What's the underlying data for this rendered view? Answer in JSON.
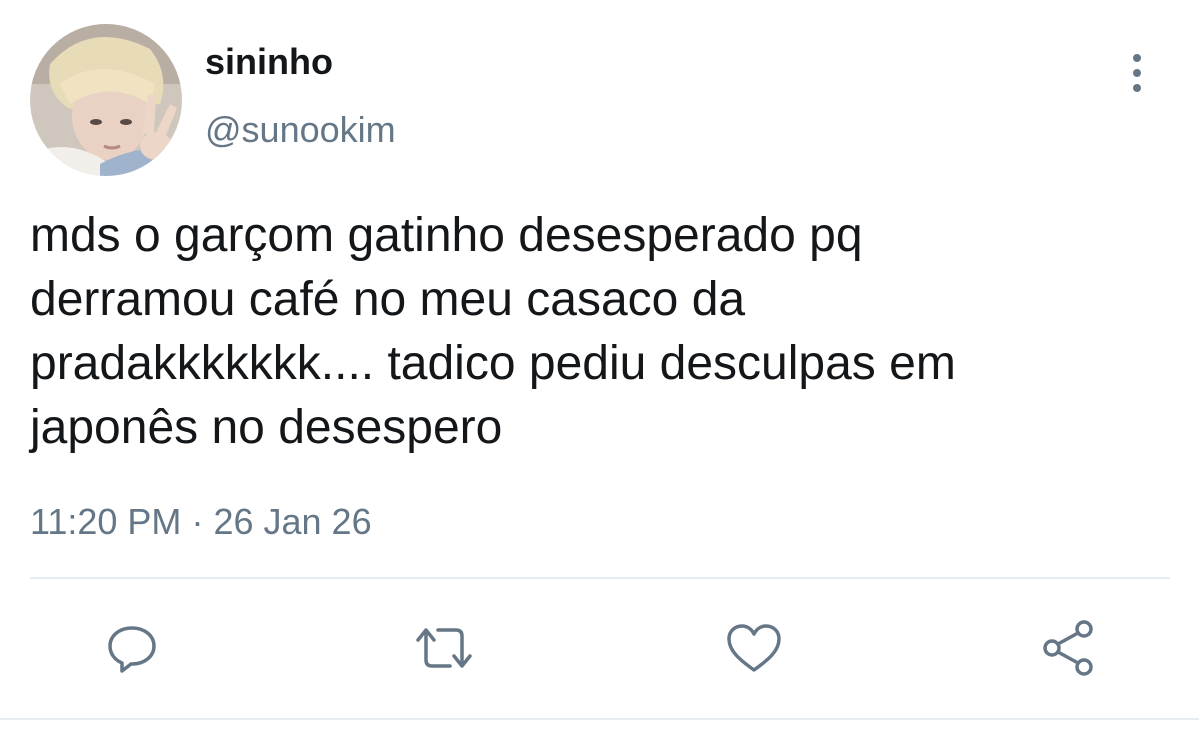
{
  "user": {
    "display_name": "sininho",
    "handle": "@sunookim"
  },
  "tweet": {
    "lines": [
      "mds o garçom gatinho desesperado pq",
      "derramou café no meu casaco da",
      "pradakkkkkkk.... tadico pediu desculpas em",
      "japonês no desespero"
    ],
    "time": "11:20 PM",
    "separator": "·",
    "date": "26 Jan 26"
  },
  "actions": [
    {
      "name": "reply",
      "icon": "reply-icon"
    },
    {
      "name": "retweet",
      "icon": "retweet-icon"
    },
    {
      "name": "like",
      "icon": "heart-icon"
    },
    {
      "name": "share",
      "icon": "share-icon"
    }
  ],
  "colors": {
    "text": "#14171a",
    "secondary": "#657786",
    "divider": "#e6ecf0"
  }
}
